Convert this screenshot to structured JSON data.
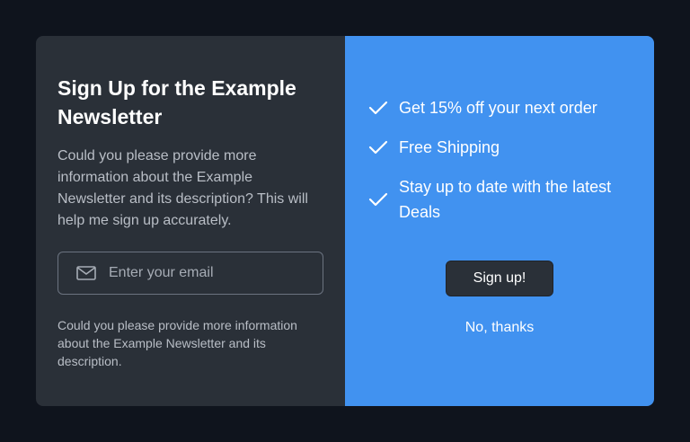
{
  "left_panel": {
    "title": "Sign Up for the Example Newsletter",
    "description": "Could you please provide more information about the Example Newsletter and its description? This will help me sign up accurately.",
    "email": {
      "icon": "mail-icon",
      "placeholder": "Enter your email",
      "value": ""
    },
    "note": "Could you please provide more information about the Example Newsletter and its description."
  },
  "right_panel": {
    "benefits": [
      {
        "icon": "check-icon",
        "text": "Get 15% off your next order"
      },
      {
        "icon": "check-icon",
        "text": "Free Shipping"
      },
      {
        "icon": "check-icon",
        "text": "Stay up to date with the latest Deals"
      }
    ],
    "signup_label": "Sign up!",
    "decline_label": "No, thanks"
  },
  "colors": {
    "background": "#0f141d",
    "left_panel": "#2a3038",
    "right_panel": "#4192f0",
    "button": "#2a3038"
  }
}
